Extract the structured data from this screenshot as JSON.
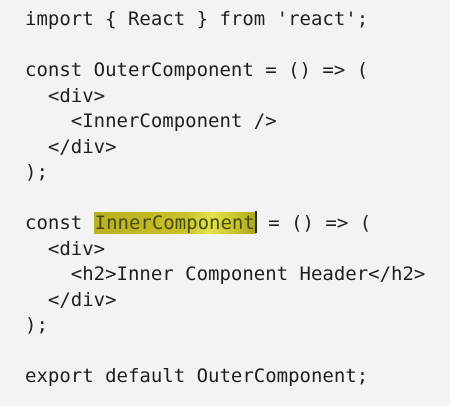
{
  "editor": {
    "lines": [
      "import { React } from 'react';",
      "",
      "const OuterComponent = () => (",
      "  <div>",
      "    <InnerComponent />",
      "  </div>",
      ");",
      "",
      "const ",
      "  <div>",
      "    <h2>Inner Component Header</h2>",
      "  </div>",
      ");",
      "",
      "export default OuterComponent;"
    ],
    "highlighted_token": "InnerComponent",
    "line9_prefix": "const ",
    "line9_suffix": " = () => ("
  }
}
